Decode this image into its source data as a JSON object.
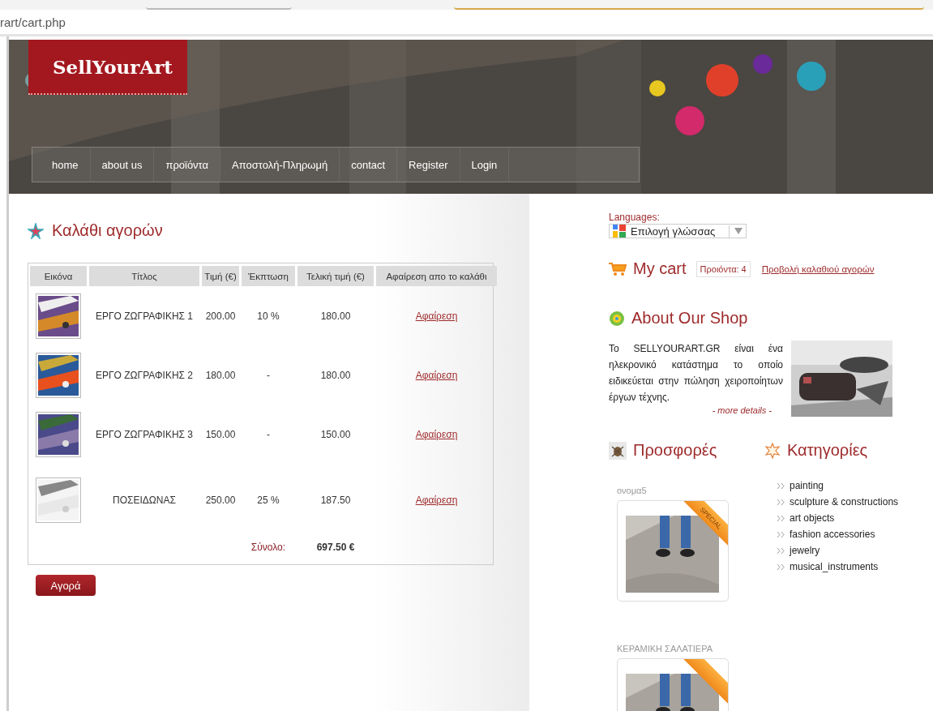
{
  "browser": {
    "address": "rart/cart.php"
  },
  "site": {
    "logo": "SellYourArt",
    "nav": [
      "home",
      "about us",
      "προϊόντα",
      "Αποστολή-Πληρωμή",
      "contact",
      "Register",
      "Login"
    ]
  },
  "cart": {
    "title": "Καλάθι αγορών",
    "columns": [
      "Εικόνα",
      "Τίτλος",
      "Τιμή (€)",
      "Έκπτωση",
      "Τελική τιμή (€)",
      "Αφαίρεση απο το καλάθι"
    ],
    "rows": [
      {
        "title": "ΕΡΓΟ ΖΩΓΡΑΦΙΚΗΣ 1",
        "price": "200.00",
        "discount": "10 %",
        "final": "180.00",
        "remove": "Αφαίρεση"
      },
      {
        "title": "ΕΡΓΟ ΖΩΓΡΑΦΙΚΗΣ 2",
        "price": "180.00",
        "discount": "-",
        "final": "180.00",
        "remove": "Αφαίρεση"
      },
      {
        "title": "ΕΡΓΟ ΖΩΓΡΑΦΙΚΗΣ 3",
        "price": "150.00",
        "discount": "-",
        "final": "150.00",
        "remove": "Αφαίρεση"
      },
      {
        "title": "ΠΟΣΕΙΔΩΝΑΣ",
        "price": "250.00",
        "discount": "25 %",
        "final": "187.50",
        "remove": "Αφαίρεση"
      }
    ],
    "total_label": "Σύνολο:",
    "total": "697.50 €",
    "buy_button": "Αγορά"
  },
  "sidebar": {
    "languages": {
      "label": "Languages:",
      "select": "Επιλογή γλώσσας"
    },
    "my_cart": {
      "title": "My cart",
      "count": "Προιόντα: 4",
      "link": "Προβολή καλαθιού αγορών"
    },
    "about": {
      "title": "About Our Shop",
      "text": "Το SELLYOURART.GR είναι ένα ηλεκρονικό κατάστημα το οποίο ειδικεύεται στην πώληση χειροποίητων έργων τέχνης.",
      "more": "- more details -"
    },
    "offers": {
      "title": "Προσφορές",
      "products": [
        {
          "name": "ονομα5",
          "ribbon": true,
          "badge": "SPECIAL"
        },
        {
          "name": "ΚΕΡΑΜΙΚΗ ΣΑΛΑΤΙΕΡΑ",
          "ribbon": true
        }
      ]
    },
    "categories": {
      "title": "Κατηγορίες",
      "items": [
        "painting",
        "sculpture & constructions",
        "art objects",
        "fashion accessories",
        "jewelry",
        "musical_instruments"
      ]
    }
  }
}
